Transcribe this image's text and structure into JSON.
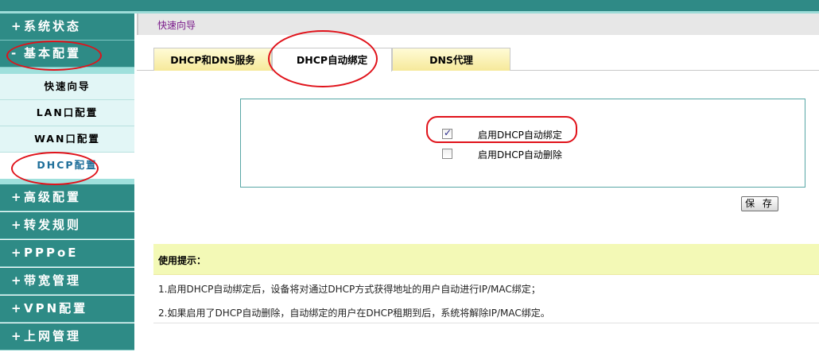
{
  "sidebar": {
    "groups": [
      {
        "sign": "+",
        "label": "系统状态"
      },
      {
        "sign": "-",
        "label": "基本配置"
      },
      {
        "sign": "+",
        "label": "高级配置"
      },
      {
        "sign": "+",
        "label": "转发规则"
      },
      {
        "sign": "+",
        "label": "PPPoE"
      },
      {
        "sign": "+",
        "label": "带宽管理"
      },
      {
        "sign": "+",
        "label": "VPN配置"
      },
      {
        "sign": "+",
        "label": "上网管理"
      }
    ],
    "sub_items": [
      {
        "label": "快速向导"
      },
      {
        "label": "LAN口配置"
      },
      {
        "label": "WAN口配置"
      },
      {
        "label": "DHCP配置",
        "active": true
      }
    ]
  },
  "header": {
    "breadcrumb": "快速向导"
  },
  "tabs": [
    {
      "label": "DHCP和DNS服务"
    },
    {
      "label": "DHCP自动绑定",
      "active": true
    },
    {
      "label": "DNS代理"
    }
  ],
  "options": {
    "auto_bind": {
      "label": "启用DHCP自动绑定",
      "checked": true
    },
    "auto_delete": {
      "label": "启用DHCP自动删除",
      "checked": false
    }
  },
  "actions": {
    "save_label": "保 存"
  },
  "tips": {
    "title": "使用提示：",
    "lines": [
      "1.启用DHCP自动绑定后，设备将对通过DHCP方式获得地址的用户自动进行IP/MAC绑定；",
      "2.如果启用了DHCP自动删除，自动绑定的用户在DHCP租期到后，系统将解除IP/MAC绑定。"
    ]
  },
  "colors": {
    "sidebar_bg": "#2e8b86",
    "sub_bg": "#e2f6f6",
    "annotation": "#e0121a",
    "tip_bg": "#f3f9b6"
  }
}
